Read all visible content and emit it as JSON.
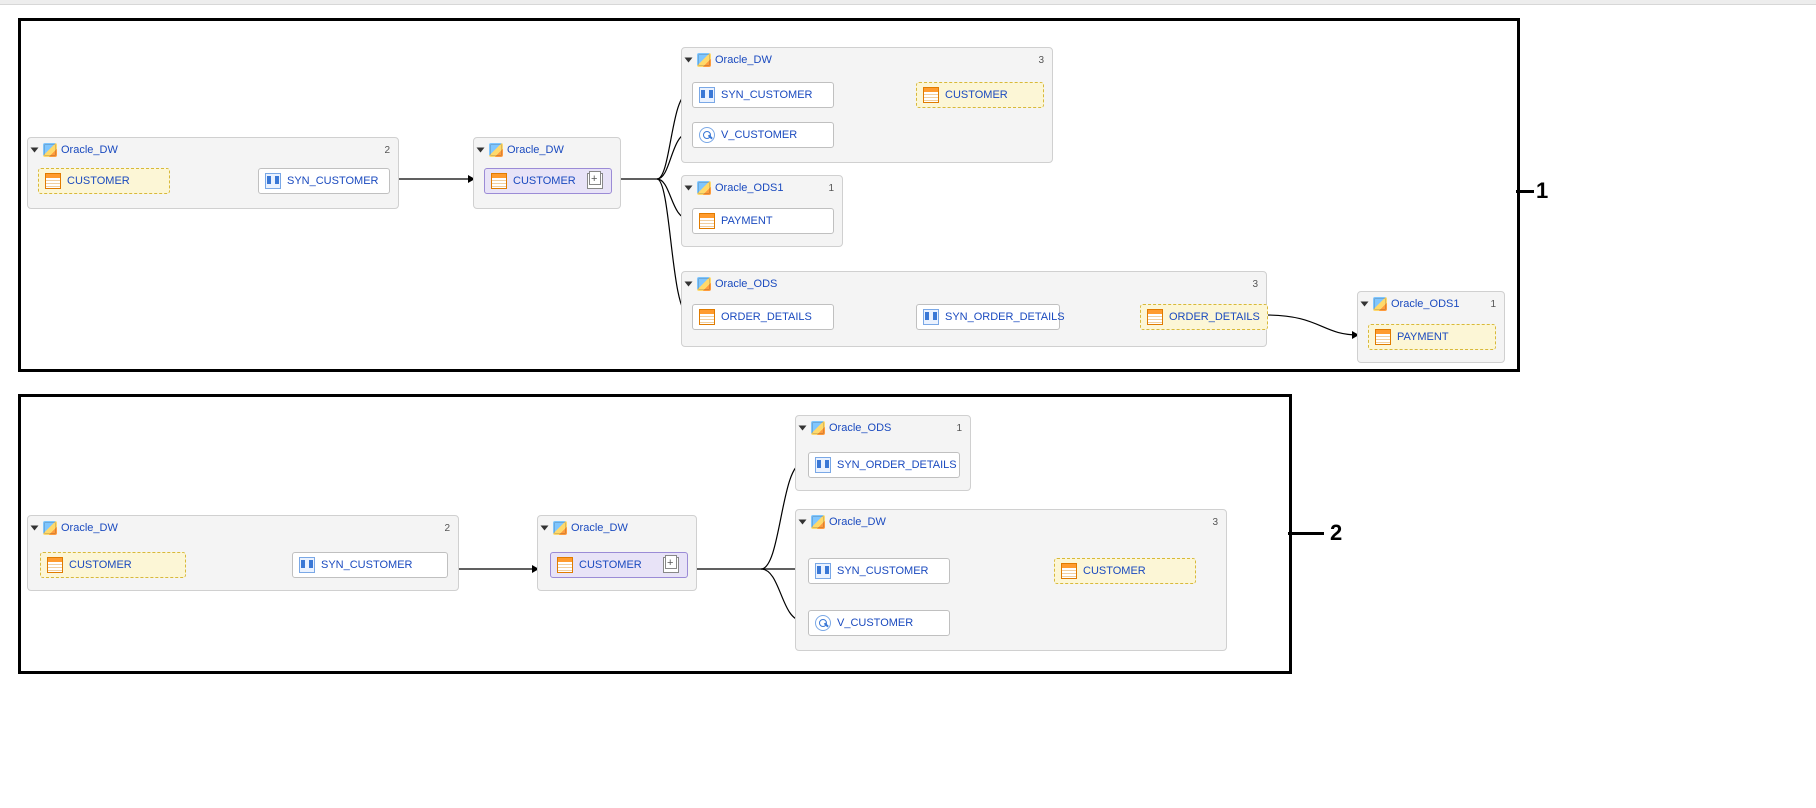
{
  "panels": {
    "p1": {
      "label": "1"
    },
    "p2": {
      "label": "2"
    }
  },
  "groups": {
    "g1a": {
      "title": "Oracle_DW",
      "count": "2"
    },
    "g1b": {
      "title": "Oracle_DW",
      "count": ""
    },
    "g1c": {
      "title": "Oracle_DW",
      "count": "3"
    },
    "g1d": {
      "title": "Oracle_ODS1",
      "count": "1"
    },
    "g1e": {
      "title": "Oracle_ODS",
      "count": "3"
    },
    "g1f": {
      "title": "Oracle_ODS1",
      "count": "1"
    },
    "g2a": {
      "title": "Oracle_DW",
      "count": "2"
    },
    "g2b": {
      "title": "Oracle_DW",
      "count": ""
    },
    "g2c": {
      "title": "Oracle_ODS",
      "count": "1"
    },
    "g2d": {
      "title": "Oracle_DW",
      "count": "3"
    }
  },
  "nodes": {
    "n_g1a_customer": "CUSTOMER",
    "n_g1a_syn": "SYN_CUSTOMER",
    "n_g1b_customer": "CUSTOMER",
    "n_g1c_syn": "SYN_CUSTOMER",
    "n_g1c_view": "V_CUSTOMER",
    "n_g1c_cust": "CUSTOMER",
    "n_g1d_payment": "PAYMENT",
    "n_g1e_order": "ORDER_DETAILS",
    "n_g1e_syn": "SYN_ORDER_DETAILS",
    "n_g1e_ord2": "ORDER_DETAILS",
    "n_g1f_payment": "PAYMENT",
    "n_g2a_customer": "CUSTOMER",
    "n_g2a_syn": "SYN_CUSTOMER",
    "n_g2b_customer": "CUSTOMER",
    "n_g2c_syn": "SYN_ORDER_DETAILS",
    "n_g2d_syn": "SYN_CUSTOMER",
    "n_g2d_view": "V_CUSTOMER",
    "n_g2d_cust": "CUSTOMER"
  }
}
